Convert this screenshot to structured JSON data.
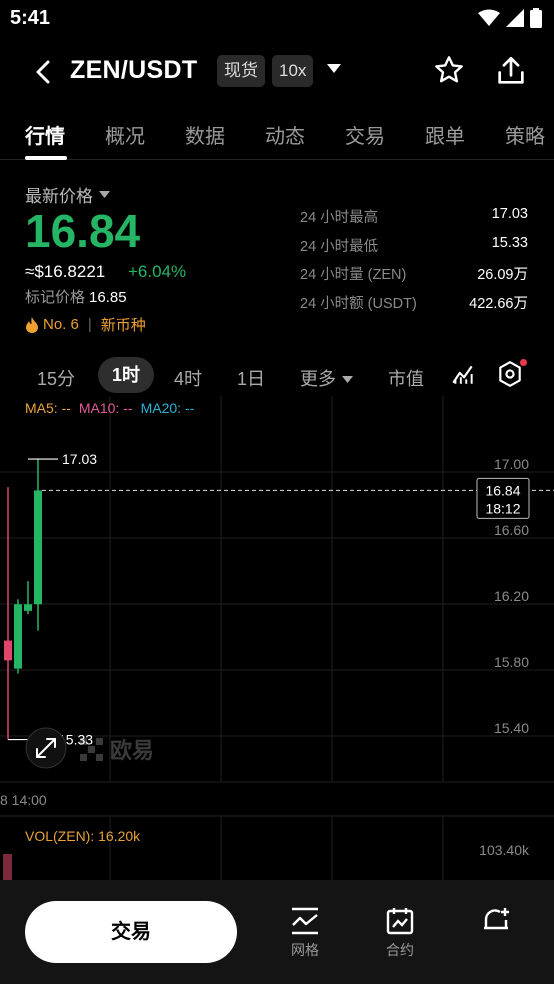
{
  "status": {
    "time": "5:41"
  },
  "header": {
    "pair": "ZEN/USDT",
    "market_tag": "现货",
    "leverage_tag": "10x"
  },
  "tabs": [
    "行情",
    "概况",
    "数据",
    "动态",
    "交易",
    "跟单",
    "策略"
  ],
  "price": {
    "label": "最新价格",
    "last": "16.84",
    "usd": "≈$16.8221",
    "change": "+6.04%",
    "mark_label": "标记价格",
    "mark_value": "16.85",
    "rank": "No. 6",
    "tag": "新币种"
  },
  "stats": [
    {
      "label": "24 小时最高",
      "value": "17.03"
    },
    {
      "label": "24 小时最低",
      "value": "15.33"
    },
    {
      "label": "24 小时量 (ZEN)",
      "value": "26.09万"
    },
    {
      "label": "24 小时额 (USDT)",
      "value": "422.66万"
    }
  ],
  "intervals": {
    "items": [
      "15分",
      "1时",
      "4时",
      "1日"
    ],
    "more": "更多",
    "market_cap": "市值"
  },
  "ma_legend": {
    "ma5": "MA5: --",
    "ma10": "MA10: --",
    "ma20": "MA20: --"
  },
  "chart_data": {
    "type": "candlestick",
    "y_ticks": [
      "17.00",
      "16.60",
      "16.20",
      "15.80",
      "15.40"
    ],
    "ylim": [
      15.18,
      17.28
    ],
    "current_price": "16.84",
    "countdown": "18:12",
    "high_marker": "17.03",
    "low_marker": "15.33",
    "time_label": "8 14:00",
    "candles": [
      {
        "open": 15.93,
        "close": 15.81,
        "high": 16.86,
        "low": 15.33
      },
      {
        "open": 15.76,
        "close": 16.15,
        "high": 16.18,
        "low": 15.73
      },
      {
        "open": 16.11,
        "close": 16.15,
        "high": 16.29,
        "low": 16.09
      },
      {
        "open": 16.15,
        "close": 16.84,
        "high": 17.03,
        "low": 15.99
      }
    ],
    "volume_label": "VOL(ZEN): 16.20k",
    "volume_tick": "103.40k",
    "watermark": "欧易"
  },
  "bottom_bar": {
    "trade": "交易",
    "grid": "网格",
    "contract": "合约"
  },
  "colors": {
    "up": "#25b565",
    "down": "#e0466a",
    "accent": "#f0a030"
  }
}
